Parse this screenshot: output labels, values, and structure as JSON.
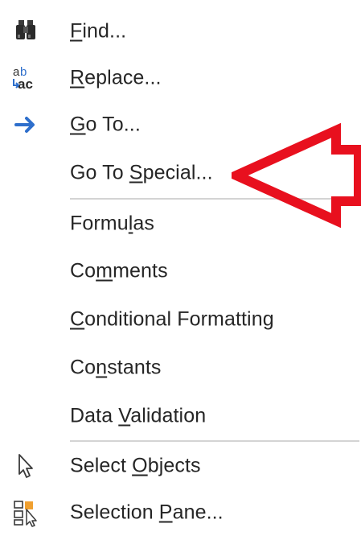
{
  "menu": {
    "items": [
      {
        "id": "find",
        "label": "Find...",
        "icon": "binoculars-icon",
        "underline_index": 0
      },
      {
        "id": "replace",
        "label": "Replace...",
        "icon": "replace-ab-ac-icon",
        "underline_index": 0
      },
      {
        "id": "goto",
        "label": "Go To...",
        "icon": "arrow-right-icon",
        "underline_index": 0
      },
      {
        "id": "goto-special",
        "label": "Go To Special...",
        "icon": "",
        "underline_index": 6
      },
      {
        "id": "formulas",
        "label": "Formulas",
        "icon": "",
        "underline_index": 5
      },
      {
        "id": "comments",
        "label": "Comments",
        "icon": "",
        "underline_index": 2
      },
      {
        "id": "conditional-formatting",
        "label": "Conditional Formatting",
        "icon": "",
        "underline_index": 0
      },
      {
        "id": "constants",
        "label": "Constants",
        "icon": "",
        "underline_index": 2
      },
      {
        "id": "data-validation",
        "label": "Data Validation",
        "icon": "",
        "underline_index": 5
      },
      {
        "id": "select-objects",
        "label": "Select Objects",
        "icon": "pointer-arrow-icon",
        "underline_index": 7
      },
      {
        "id": "selection-pane",
        "label": "Selection Pane...",
        "icon": "selection-pane-icon",
        "underline_index": 10
      }
    ]
  },
  "annotation": {
    "color": "#e8101e",
    "target": "goto-special"
  },
  "colors": {
    "text": "#262626",
    "icon_blue": "#2e6fcc",
    "separator": "#d4d4d4",
    "pane_orange": "#f0a030"
  }
}
